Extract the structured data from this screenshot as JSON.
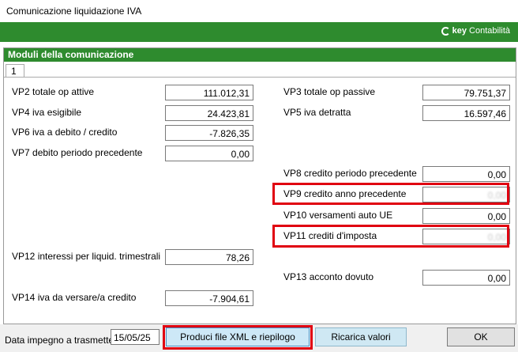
{
  "window": {
    "title": "Comunicazione liquidazione IVA"
  },
  "brand": {
    "prefix": "key",
    "suffix": "Contabilità"
  },
  "group": {
    "title": "Moduli della comunicazione",
    "tab": "1"
  },
  "fields": {
    "vp2": {
      "label": "VP2 totale op attive",
      "value": "111.012,31"
    },
    "vp3": {
      "label": "VP3 totale op passive",
      "value": "79.751,37"
    },
    "vp4": {
      "label": "VP4 iva esigibile",
      "value": "24.423,81"
    },
    "vp5": {
      "label": "VP5 iva detratta",
      "value": "16.597,46"
    },
    "vp6": {
      "label": "VP6 iva a debito / credito",
      "value": "-7.826,35"
    },
    "vp7": {
      "label": "VP7 debito periodo precedente",
      "value": "0,00"
    },
    "vp8": {
      "label": "VP8 credito periodo precedente",
      "value": "0,00"
    },
    "vp9": {
      "label": "VP9 credito anno precedente",
      "value": "0,00"
    },
    "vp10": {
      "label": "VP10 versamenti auto UE",
      "value": "0,00"
    },
    "vp11": {
      "label": "VP11 crediti d'imposta",
      "value": "0,00"
    },
    "vp12": {
      "label": "VP12 interessi per liquid. trimestrali",
      "value": "78,26"
    },
    "vp13": {
      "label": "VP13 acconto dovuto",
      "value": "0,00"
    },
    "vp14": {
      "label": "VP14 iva da versare/a credito",
      "value": "-7.904,61"
    }
  },
  "footer": {
    "date_label": "Data impegno a trasmettere",
    "date_value": "15/05/25",
    "xml_button": "Produci file XML e riepilogo",
    "reload_button": "Ricarica valori",
    "ok_button": "OK"
  },
  "colors": {
    "accent_green": "#2e8b2e",
    "highlight_red": "#e00010"
  }
}
